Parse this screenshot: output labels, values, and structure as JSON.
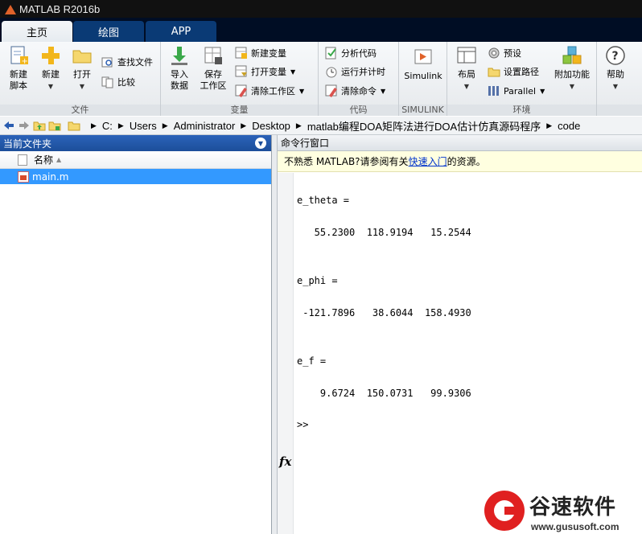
{
  "window": {
    "title": "MATLAB R2016b"
  },
  "tabs": [
    {
      "label": "主页",
      "active": true
    },
    {
      "label": "绘图",
      "active": false
    },
    {
      "label": "APP",
      "active": false
    }
  ],
  "ribbon": {
    "file": {
      "label": "文件",
      "new_script": "新建\n脚本",
      "new": "新建",
      "open": "打开",
      "find_files": "查找文件",
      "compare": "比较"
    },
    "variable": {
      "label": "变量",
      "import_data": "导入\n数据",
      "save_workspace": "保存\n工作区",
      "new_variable": "新建变量",
      "open_variable": "打开变量",
      "clear_workspace": "清除工作区"
    },
    "code": {
      "label": "代码",
      "analyze_code": "分析代码",
      "run_and_time": "运行并计时",
      "clear_commands": "清除命令"
    },
    "simulink": {
      "label": "SIMULINK",
      "button": "Simulink"
    },
    "environment": {
      "label": "环境",
      "layout": "布局",
      "preferences": "预设",
      "set_path": "设置路径",
      "parallel": "Parallel",
      "addons": "附加功能"
    },
    "help": {
      "label": "帮助"
    }
  },
  "address": {
    "crumbs": [
      "C:",
      "Users",
      "Administrator",
      "Desktop",
      "matlab编程DOA矩阵法进行DOA估计仿真源码程序",
      "code"
    ]
  },
  "current_folder": {
    "title": "当前文件夹",
    "column_name": "名称",
    "files": [
      {
        "name": "main.m",
        "selected": true
      }
    ]
  },
  "command_window": {
    "title": "命令行窗口",
    "hint_before": "不熟悉 MATLAB?请参阅有关",
    "hint_link": "快速入门",
    "hint_after": "的资源。",
    "outputs": [
      {
        "name": "e_theta =",
        "values": "   55.2300  118.9194   15.2544"
      },
      {
        "name": "e_phi =",
        "values": " -121.7896   38.6044  158.4930"
      },
      {
        "name": "e_f =",
        "values": "    9.6724  150.0731   99.9306"
      }
    ],
    "prompt": ">>",
    "fx_label": "fx"
  },
  "watermark": {
    "name": "谷速软件",
    "url": "www.gususoft.com"
  },
  "colors": {
    "selection": "#3399ff",
    "panel_header": "#1c4e9a",
    "tab_bar": "#000d24",
    "watermark_red": "#e02020"
  }
}
